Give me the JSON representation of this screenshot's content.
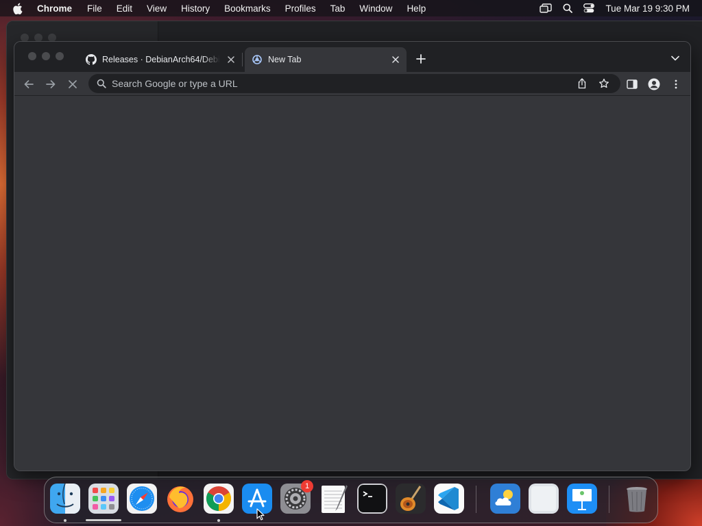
{
  "menubar": {
    "app_name": "Chrome",
    "menus": [
      "File",
      "Edit",
      "View",
      "History",
      "Bookmarks",
      "Profiles",
      "Tab",
      "Window",
      "Help"
    ],
    "clock": "Tue Mar 19  9:30 PM"
  },
  "browser": {
    "tabs": [
      {
        "title": "Releases · DebianArch64/Debi",
        "favicon": "github-icon",
        "active": false
      },
      {
        "title": "New Tab",
        "favicon": "chrome-newtab-icon",
        "active": true
      }
    ],
    "omnibox": {
      "placeholder": "Search Google or type a URL",
      "value": ""
    }
  },
  "dock": {
    "apps": [
      {
        "name": "Finder",
        "icon": "finder-icon",
        "running": true
      },
      {
        "name": "Launchpad",
        "icon": "launchpad-icon",
        "running": false
      },
      {
        "name": "Safari",
        "icon": "safari-icon",
        "running": false
      },
      {
        "name": "Firefox",
        "icon": "firefox-icon",
        "running": false
      },
      {
        "name": "Google Chrome",
        "icon": "chrome-icon",
        "running": true
      },
      {
        "name": "App Store",
        "icon": "app-store-icon",
        "running": false
      },
      {
        "name": "System Settings",
        "icon": "system-settings-icon",
        "running": false,
        "badge": "1"
      },
      {
        "name": "TextEdit",
        "icon": "textedit-icon",
        "running": false
      },
      {
        "name": "Terminal",
        "icon": "terminal-icon",
        "running": false
      },
      {
        "name": "GarageBand",
        "icon": "garageband-icon",
        "running": false
      },
      {
        "name": "Visual Studio Code",
        "icon": "vscode-icon",
        "running": false
      },
      {
        "name": "Weather",
        "icon": "weather-icon",
        "running": false
      },
      {
        "name": "Preview",
        "icon": "preview-icon",
        "running": false
      },
      {
        "name": "Keynote",
        "icon": "keynote-icon",
        "running": false
      },
      {
        "name": "Trash",
        "icon": "trash-icon",
        "running": false
      }
    ]
  },
  "colors": {
    "chrome_frame": "#202124",
    "chrome_toolbar": "#35363a",
    "badge": "#ee3b33"
  }
}
